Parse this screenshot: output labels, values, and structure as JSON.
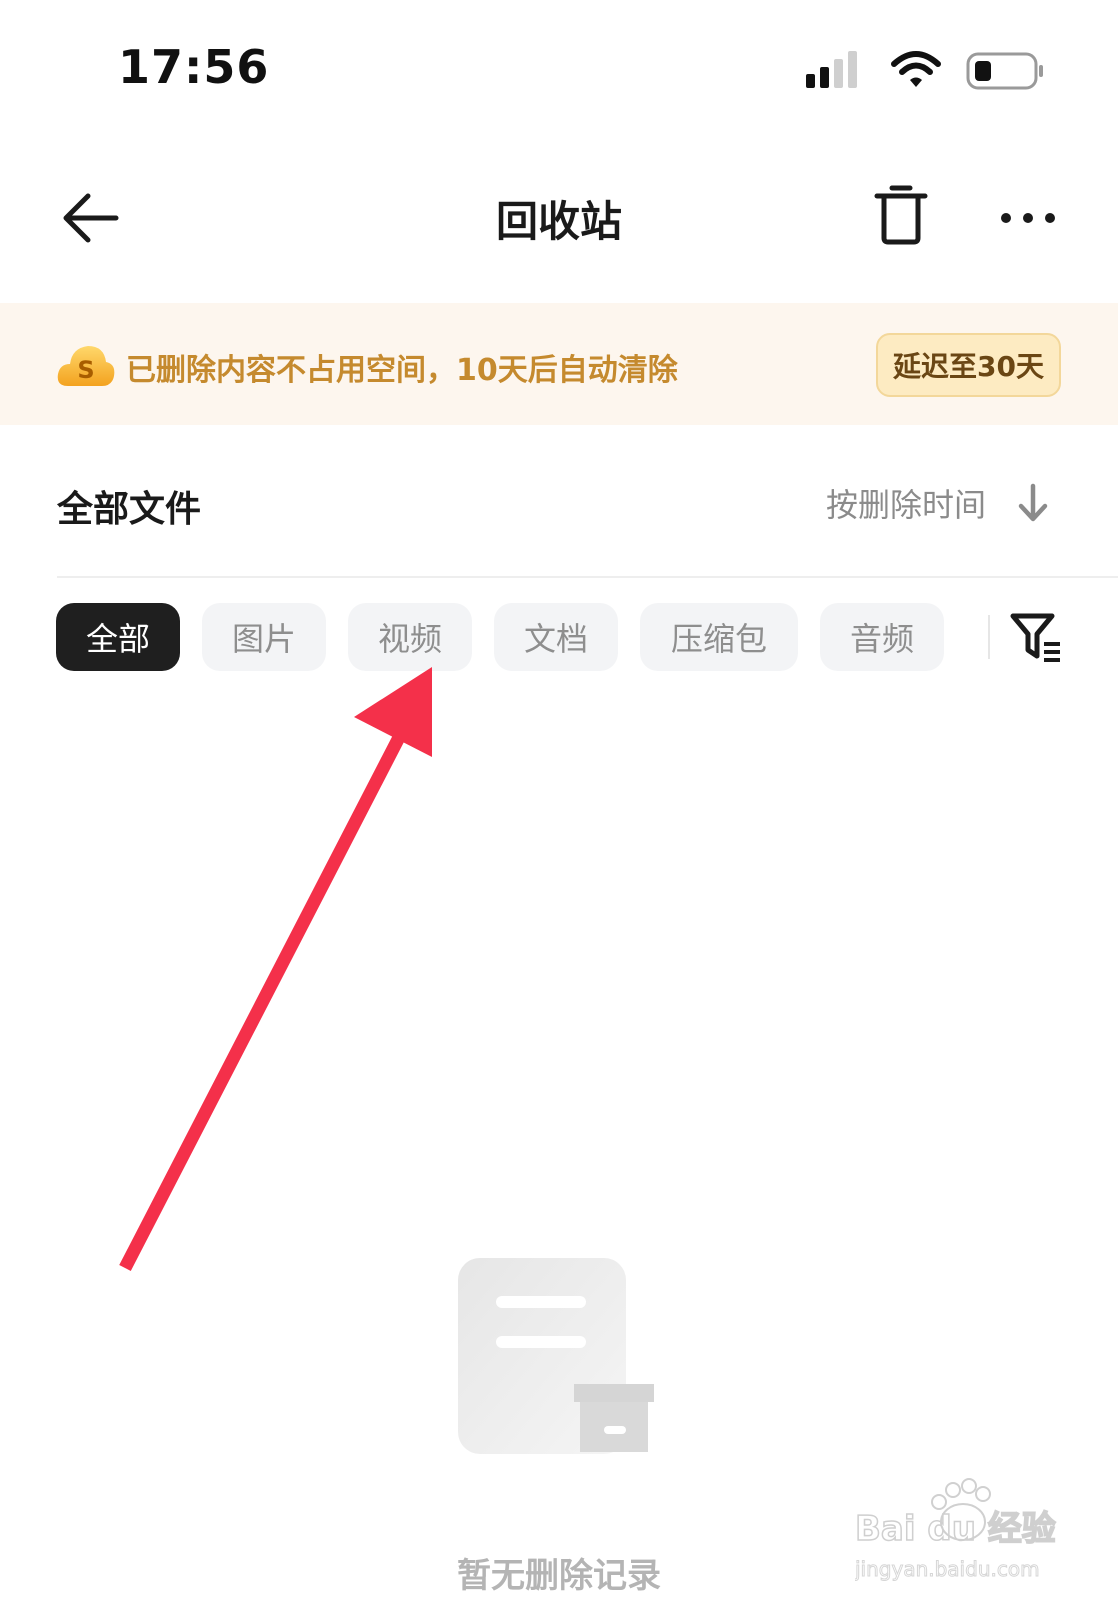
{
  "status_bar": {
    "time": "17:56"
  },
  "nav": {
    "title": "回收站"
  },
  "banner": {
    "text": "已删除内容不占用空间，10天后自动清除",
    "button_label": "延迟至30天",
    "text_color": "#c58a2e",
    "background": "#fdf6ee"
  },
  "list_header": {
    "title": "全部文件",
    "sort_label": "按删除时间"
  },
  "filters": {
    "chips": [
      {
        "label": "全部",
        "active": true
      },
      {
        "label": "图片",
        "active": false
      },
      {
        "label": "视频",
        "active": false
      },
      {
        "label": "文档",
        "active": false
      },
      {
        "label": "压缩包",
        "active": false
      },
      {
        "label": "音频",
        "active": false
      }
    ]
  },
  "empty_state": {
    "text": "暂无删除记录"
  },
  "annotation": {
    "arrow_color": "#f4304a"
  },
  "watermark": {
    "brand": "Bai du 经验",
    "url": "jingyan.baidu.com"
  }
}
